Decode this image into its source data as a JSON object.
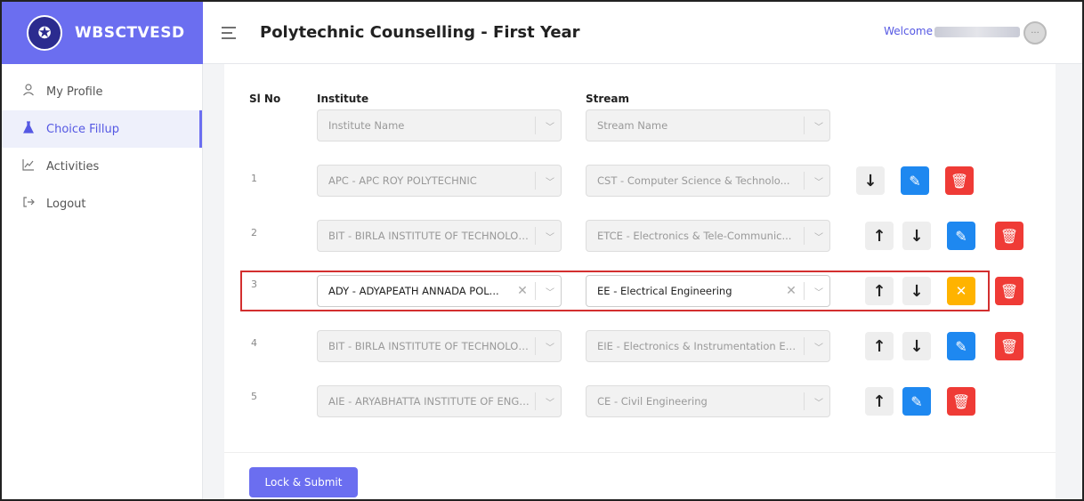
{
  "brand": {
    "name": "WBSCTVESD",
    "logo_icon": "emblem-icon"
  },
  "header": {
    "title": "Polytechnic Counselling - First Year",
    "welcome": "Welcome"
  },
  "sidebar": {
    "items": [
      {
        "label": "My Profile",
        "icon": "user-icon"
      },
      {
        "label": "Choice Fillup",
        "icon": "flask-icon"
      },
      {
        "label": "Activities",
        "icon": "chart-icon"
      },
      {
        "label": "Logout",
        "icon": "logout-icon"
      }
    ]
  },
  "table": {
    "headers": {
      "sl": "Sl No",
      "institute": "Institute",
      "stream": "Stream"
    },
    "placeholders": {
      "institute": "Institute Name",
      "stream": "Stream Name"
    },
    "rows": [
      {
        "num": "1",
        "institute": "APC - APC ROY POLYTECHNIC",
        "stream": "CST - Computer Science & Technolo..."
      },
      {
        "num": "2",
        "institute": "BIT - BIRLA INSTITUTE OF TECHNOLOGY",
        "stream": "ETCE - Electronics & Tele-Communic..."
      },
      {
        "num": "3",
        "institute": "ADY - ADYAPEATH ANNADA POL...",
        "stream": "EE - Electrical Engineering"
      },
      {
        "num": "4",
        "institute": "BIT - BIRLA INSTITUTE OF TECHNOLOGY",
        "stream": "EIE - Electronics & Instrumentation En..."
      },
      {
        "num": "5",
        "institute": "AIE - ARYABHATTA INSTITUTE OF ENGG...",
        "stream": "CE - Civil Engineering"
      }
    ]
  },
  "footer": {
    "submit_label": "Lock & Submit"
  },
  "colors": {
    "brand": "#6b6ef0",
    "edit": "#1e88f0",
    "delete": "#ef3b36",
    "cancel": "#ffb300",
    "highlight": "#d32f2f"
  }
}
